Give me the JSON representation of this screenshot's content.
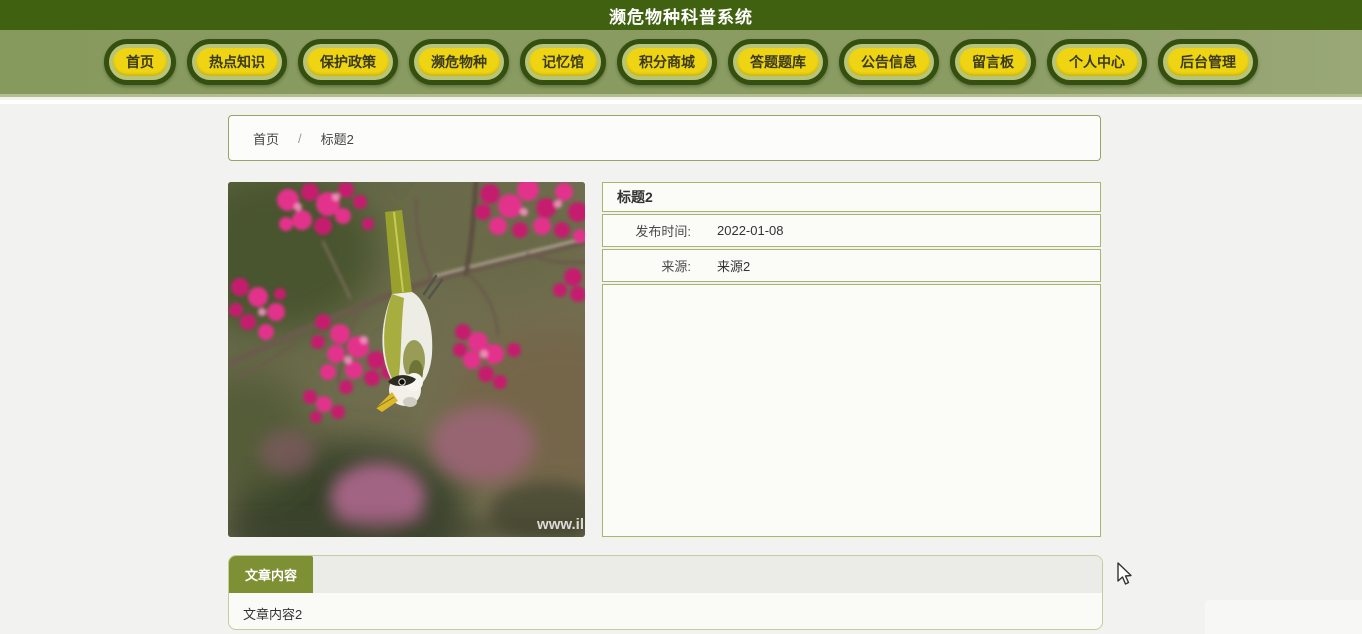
{
  "header": {
    "title": "濒危物种科普系统"
  },
  "nav": {
    "items": [
      "首页",
      "热点知识",
      "保护政策",
      "濒危物种",
      "记忆馆",
      "积分商城",
      "答题题库",
      "公告信息",
      "留言板",
      "个人中心",
      "后台管理"
    ]
  },
  "breadcrumb": {
    "home": "首页",
    "separator": "/",
    "current": "标题2"
  },
  "article": {
    "title": "标题2",
    "publish_label": "发布时间:",
    "publish_date": "2022-01-08",
    "source_label": "来源:",
    "source_value": "来源2",
    "image": {
      "description": "粉色樱花枝头倒挂的绣眼鸟照片",
      "watermark": "www.il"
    }
  },
  "content": {
    "tab_label": "文章内容",
    "body": "文章内容2"
  },
  "colors": {
    "header_green": "#40610f",
    "nav_olive": "#8b9c63",
    "button_yellow": "#eed413",
    "button_ring_green": "#344f10",
    "panel_border_olive": "#a9b46e",
    "tab_green": "#7d9033",
    "page_bg": "#f2f3f0"
  }
}
